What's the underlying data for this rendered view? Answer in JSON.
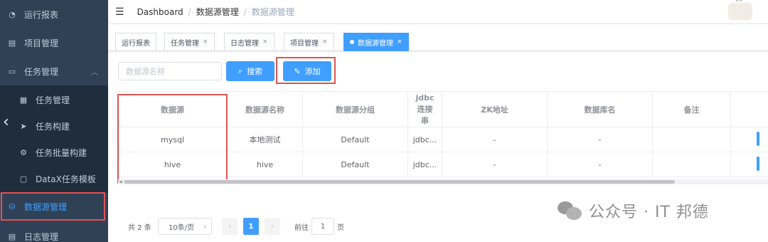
{
  "sidebar": {
    "items": [
      {
        "label": "运行报表",
        "icon": "dashboard-icon"
      },
      {
        "label": "项目管理",
        "icon": "list-icon"
      },
      {
        "label": "任务管理",
        "icon": "monitor-icon"
      },
      {
        "label": "任务管理",
        "icon": "calendar-icon"
      },
      {
        "label": "任务构建",
        "icon": "send-icon"
      },
      {
        "label": "任务批量构建",
        "icon": "settings-icon"
      },
      {
        "label": "DataX任务模板",
        "icon": "clipboard-icon"
      },
      {
        "label": "数据源管理",
        "icon": "database-icon"
      },
      {
        "label": "日志管理",
        "icon": "document-icon"
      }
    ]
  },
  "header": {
    "breadcrumb": [
      "Dashboard",
      "数据源管理",
      "数据源管理"
    ]
  },
  "tags": [
    {
      "label": "运行报表",
      "closable": false,
      "active": false
    },
    {
      "label": "任务管理",
      "closable": true,
      "active": false
    },
    {
      "label": "日志管理",
      "closable": true,
      "active": false
    },
    {
      "label": "项目管理",
      "closable": true,
      "active": false
    },
    {
      "label": "数据源管理",
      "closable": true,
      "active": true
    }
  ],
  "toolbar": {
    "search_placeholder": "数据源名称",
    "search_label": "搜索",
    "add_label": "添加"
  },
  "table": {
    "headers": [
      "数据源",
      "数据源名称",
      "数据源分组",
      "jdbc连接串",
      "ZK地址",
      "数据库名",
      "备注",
      ""
    ],
    "rows": [
      [
        "mysql",
        "本地测试",
        "Default",
        "jdbc...",
        "-",
        "-",
        "",
        ""
      ],
      [
        "hive",
        "hive",
        "Default",
        "jdbc...",
        "-",
        "-",
        "",
        ""
      ]
    ]
  },
  "pagination": {
    "total": "共 2 条",
    "page_size": "10条/页",
    "current_page": "1",
    "goto_label": "前往",
    "goto_value": "1",
    "page_suffix": "页"
  },
  "watermark": {
    "text": "公众号 · IT 邦德"
  },
  "colors": {
    "sidebar_bg": "#304156",
    "primary": "#409eff",
    "highlight_border": "#e05353"
  }
}
